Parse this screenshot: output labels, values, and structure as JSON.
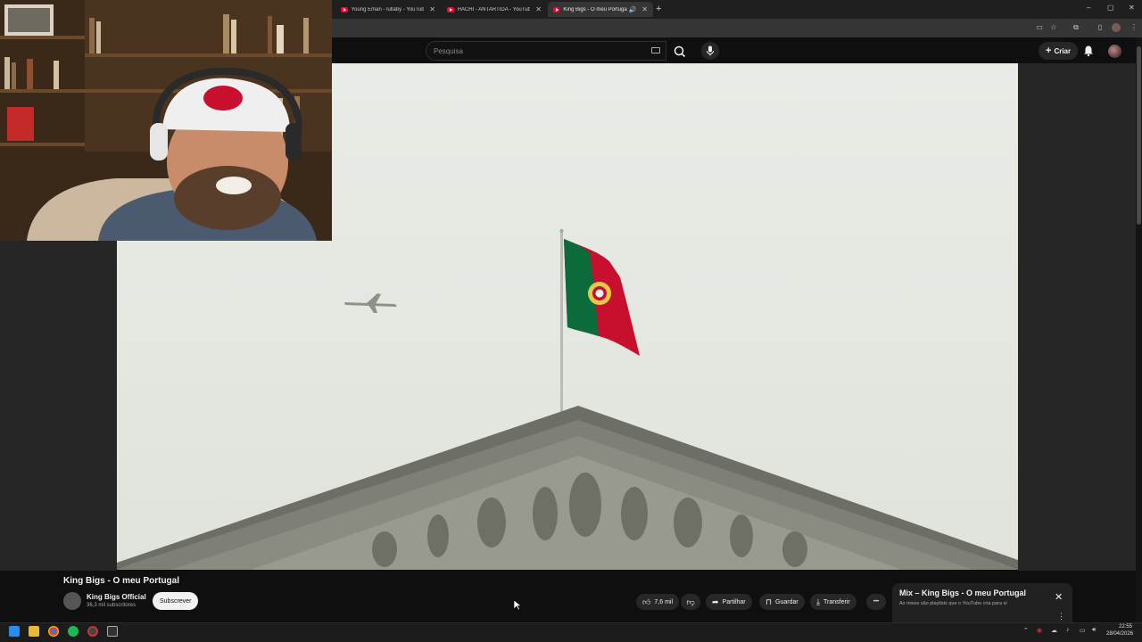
{
  "browser": {
    "tabs": [
      {
        "label": "Young Eman - lullaby - YouTube",
        "active": false
      },
      {
        "label": "HACHI - ANTARTIDA - YouTube",
        "active": false
      },
      {
        "label": "King Bigs - O meu Portugal",
        "active": true
      }
    ],
    "new_tab": "+",
    "controls": {
      "minimize": "–",
      "maximize": "▢",
      "close": "✕"
    }
  },
  "youtube": {
    "search_placeholder": "Pesquisa",
    "create_label": "Criar"
  },
  "video": {
    "title": "King Bigs - O meu Portugal",
    "channel": "King Bigs Official",
    "subscribers": "36,3 mil subscritores",
    "subscribe_label": "Subscrever",
    "likes": "7,6 mil",
    "share_label": "Partilhar",
    "save_label": "Guardar",
    "download_label": "Transferir",
    "more_label": "•••"
  },
  "mix": {
    "title": "Mix – King Bigs - O meu Portugal",
    "subtitle": "As mixes são playlists que o YouTube cria para si",
    "close": "✕",
    "menu": "⋮"
  },
  "taskbar": {
    "time": "22:55",
    "date": "28/04/2026"
  },
  "colors": {
    "youtube_red": "#ff0033",
    "flag_green": "#0b6b3a",
    "flag_red": "#c8102e"
  }
}
